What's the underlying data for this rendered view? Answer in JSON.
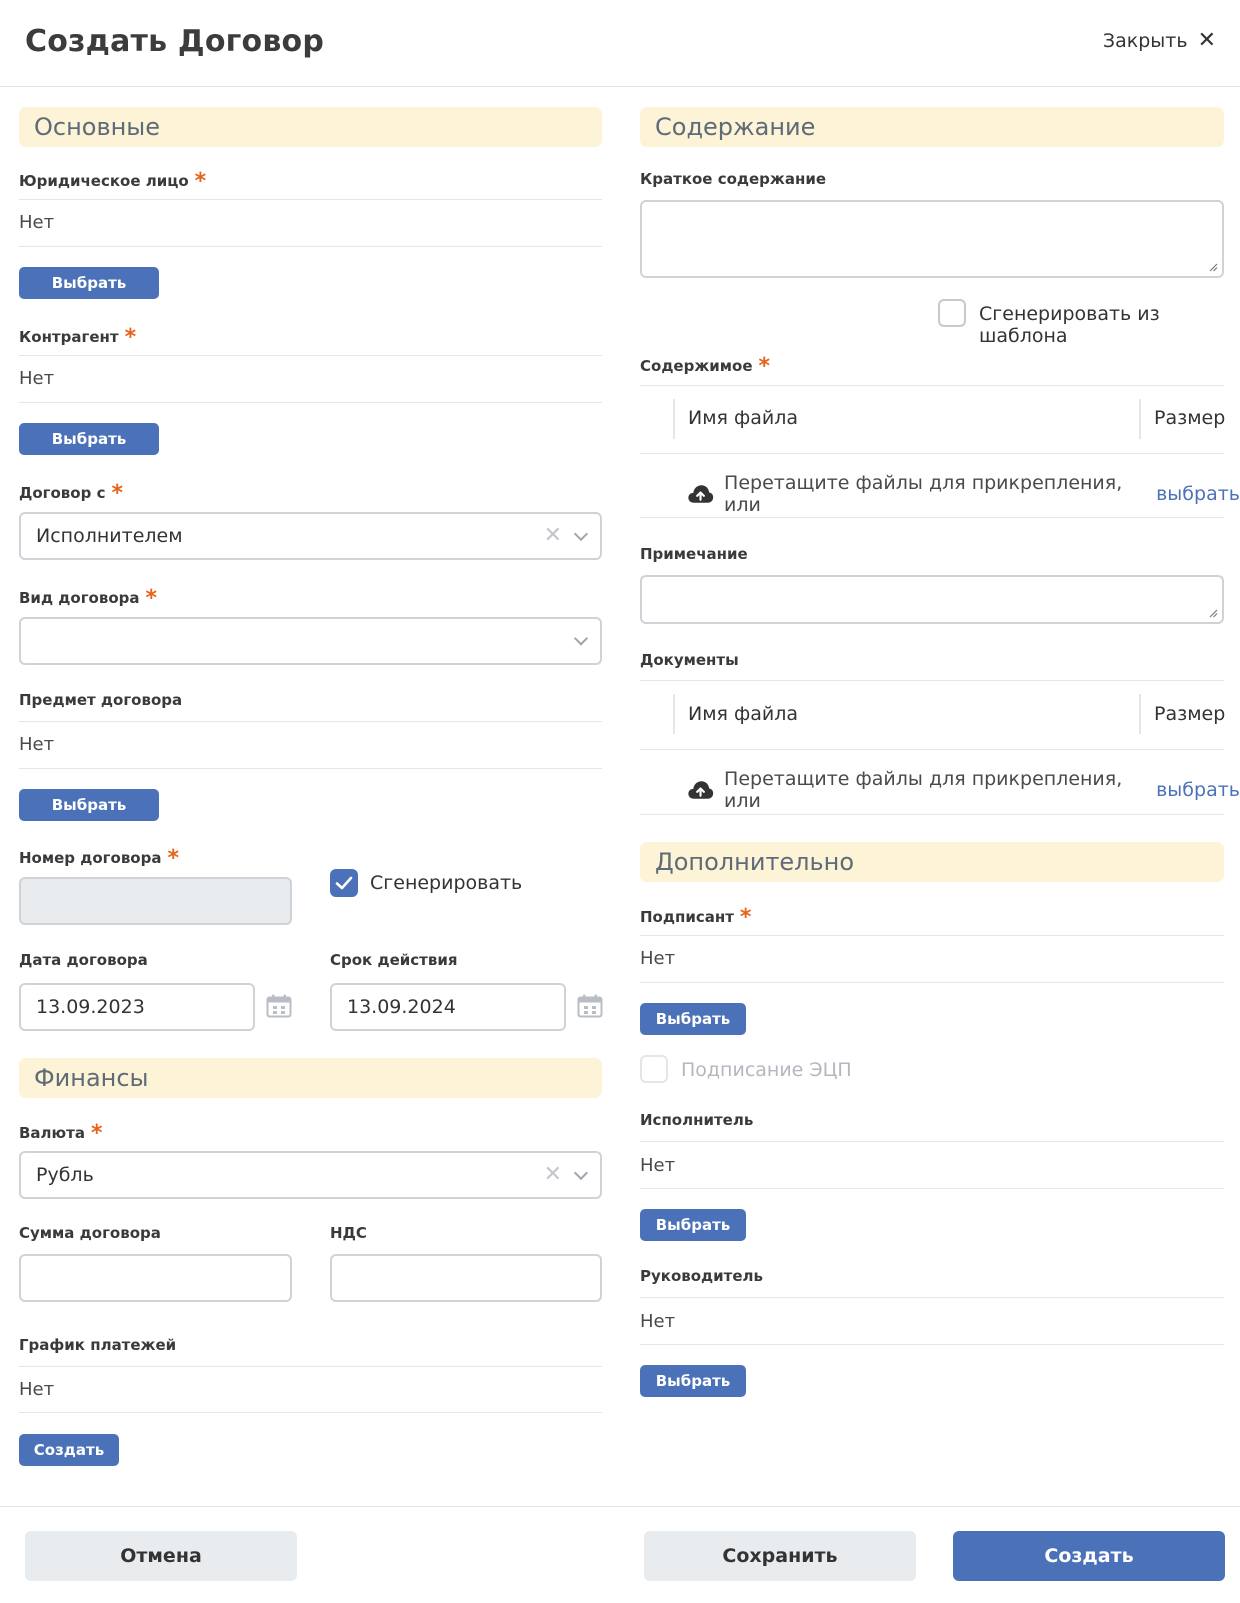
{
  "header": {
    "title": "Создать Договор",
    "close_label": "Закрыть"
  },
  "sections": {
    "basic": "Основные",
    "finance": "Финансы",
    "content": "Содержание",
    "extra": "Дополнительно"
  },
  "left": {
    "legal_entity": {
      "label": "Юридическое лицо",
      "value": "Нет",
      "button": "Выбрать"
    },
    "counterparty": {
      "label": "Контрагент",
      "value": "Нет",
      "button": "Выбрать"
    },
    "contract_with": {
      "label": "Договор с",
      "value": "Исполнителем"
    },
    "contract_type": {
      "label": "Вид договора",
      "value": ""
    },
    "subject": {
      "label": "Предмет договора",
      "value": "Нет",
      "button": "Выбрать"
    },
    "number": {
      "label": "Номер договора",
      "value": "",
      "generate_label": "Сгенерировать",
      "generate_checked": true
    },
    "date": {
      "label": "Дата договора",
      "value": "13.09.2023"
    },
    "validity": {
      "label": "Срок действия",
      "value": "13.09.2024"
    },
    "currency": {
      "label": "Валюта",
      "value": "Рубль"
    },
    "amount": {
      "label": "Сумма договора",
      "value": ""
    },
    "vat": {
      "label": "НДС",
      "value": ""
    },
    "schedule": {
      "label": "График платежей",
      "value": "Нет",
      "button": "Создать"
    }
  },
  "right": {
    "summary": {
      "label": "Краткое содержание",
      "value": ""
    },
    "template": {
      "label": "Сгенерировать из шаблона",
      "checked": false
    },
    "contents": {
      "label": "Содержимое",
      "col_name": "Имя файла",
      "col_size": "Размер",
      "drop_text": "Перетащите файлы для прикрепления, или",
      "drop_link": "выбрать"
    },
    "note": {
      "label": "Примечание",
      "value": ""
    },
    "documents": {
      "label": "Документы",
      "col_name": "Имя файла",
      "col_size": "Размер",
      "drop_text": "Перетащите файлы для прикрепления, или",
      "drop_link": "выбрать"
    },
    "signer": {
      "label": "Подписант",
      "value": "Нет",
      "button": "Выбрать"
    },
    "eds": {
      "label": "Подписание ЭЦП",
      "checked": false,
      "disabled": true
    },
    "executor": {
      "label": "Исполнитель",
      "value": "Нет",
      "button": "Выбрать"
    },
    "manager": {
      "label": "Руководитель",
      "value": "Нет",
      "button": "Выбрать"
    }
  },
  "footer": {
    "cancel": "Отмена",
    "save": "Сохранить",
    "create": "Создать"
  },
  "colors": {
    "accent": "#4b72b8",
    "section_bg": "#fdf3d7",
    "required": "#e8631a"
  }
}
